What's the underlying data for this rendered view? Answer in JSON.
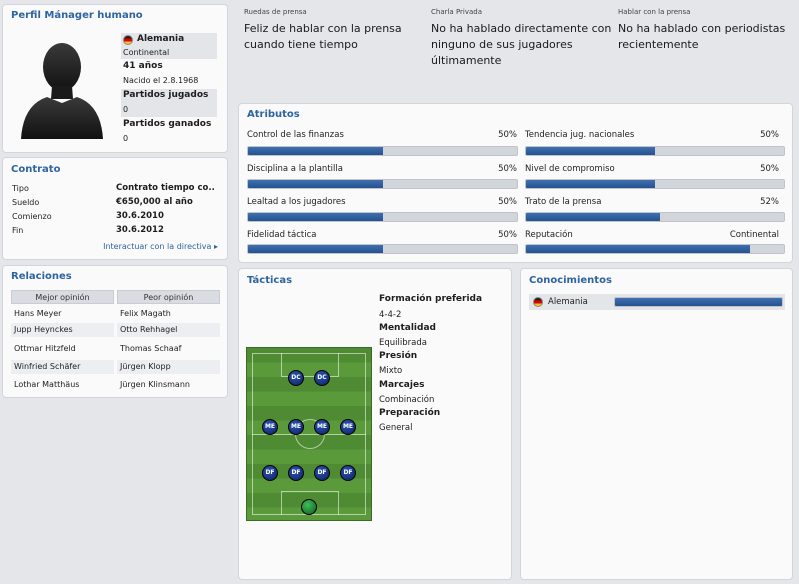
{
  "profile": {
    "title": "Perfil Mánager humano",
    "nationality": "Alemania",
    "continent": "Continental",
    "age": "41 años",
    "born": "Nacido el 2.8.1968",
    "matches_played_label": "Partidos jugados",
    "matches_played": "0",
    "matches_won_label": "Partidos ganados",
    "matches_won": "0"
  },
  "contract": {
    "title": "Contrato",
    "rows": [
      {
        "label": "Tipo",
        "value": "Contrato tiempo co.."
      },
      {
        "label": "Sueldo",
        "value": "€650,000 al año"
      },
      {
        "label": "Comienzo",
        "value": "30.6.2010"
      },
      {
        "label": "Fin",
        "value": "30.6.2012"
      }
    ],
    "link": "Interactuar con la directiva ▸"
  },
  "relations": {
    "title": "Relaciones",
    "col_best": "Mejor opinión",
    "col_worst": "Peor opinión",
    "rows": [
      {
        "best": "Hans Meyer",
        "worst": "Felix Magath"
      },
      {
        "best": "Jupp Heynckes",
        "worst": "Otto Rehhagel"
      },
      {
        "best": "Ottmar Hitzfeld",
        "worst": "Thomas Schaaf"
      },
      {
        "best": "Winfried Schäfer",
        "worst": "Jürgen Klopp"
      },
      {
        "best": "Lothar Matthäus",
        "worst": "Jürgen Klinsmann"
      }
    ]
  },
  "press": [
    {
      "label": "Ruedas de prensa",
      "text": "Feliz de hablar con la prensa cuando tiene tiempo"
    },
    {
      "label": "Charla Privada",
      "text": "No ha hablado directamente con ninguno de sus jugadores últimamente"
    },
    {
      "label": "Hablar con la prensa",
      "text": "No ha hablado con periodistas recientemente"
    }
  ],
  "attributes": {
    "title": "Atributos",
    "left": [
      {
        "label": "Control de las finanzas",
        "value": "50%",
        "fill": 0.5
      },
      {
        "label": "Disciplina a la plantilla",
        "value": "50%",
        "fill": 0.5
      },
      {
        "label": "Lealtad a los jugadores",
        "value": "50%",
        "fill": 0.5
      },
      {
        "label": "Fidelidad táctica",
        "value": "50%",
        "fill": 0.5
      }
    ],
    "right": [
      {
        "label": "Tendencia jug. nacionales",
        "value": "50%",
        "fill": 0.5
      },
      {
        "label": "Nivel de compromiso",
        "value": "50%",
        "fill": 0.5
      },
      {
        "label": "Trato de la prensa",
        "value": "52%",
        "fill": 0.52
      },
      {
        "label": "Reputación",
        "value": "Continental",
        "fill": 0.87
      }
    ]
  },
  "tactics": {
    "title": "Tácticas",
    "formation_label": "Formación preferida",
    "formation": "4-4-2",
    "mentality_label": "Mentalidad",
    "mentality": "Equilibrada",
    "pressing_label": "Presión",
    "pressing": "Mixto",
    "marking_label": "Marcajes",
    "marking": "Combinación",
    "preparation_label": "Preparación",
    "preparation": "General",
    "players": {
      "forwards": [
        "DC",
        "DC"
      ],
      "midfielders": [
        "ME",
        "ME",
        "ME",
        "ME"
      ],
      "defenders": [
        "DF",
        "DF",
        "DF",
        "DF"
      ]
    }
  },
  "knowledge": {
    "title": "Conocimientos",
    "country": "Alemania",
    "level": 1.0
  },
  "colors": {
    "accent": "#2e64a0",
    "bar_fill": "#2a5a98",
    "pitch": "#5b9a3b"
  }
}
